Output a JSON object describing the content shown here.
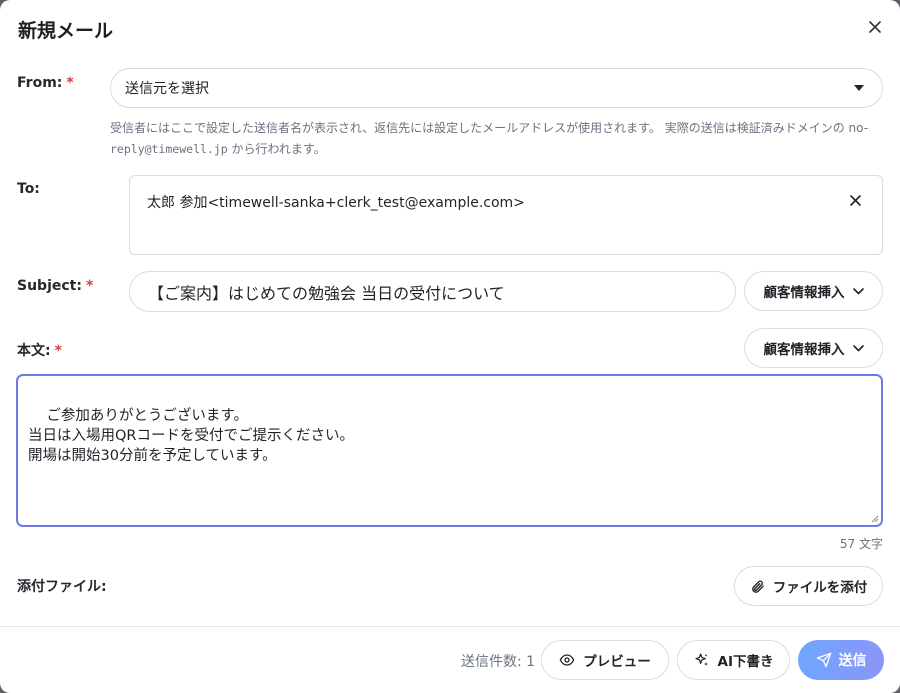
{
  "dialog": {
    "title": "新規メール"
  },
  "from": {
    "label": "From:",
    "required_mark": "*",
    "select_value": "送信元を選択",
    "help_line1": "受信者にはここで設定した送信者名が表示され、返信先には設定したメールアドレスが使用されます。 実際の送信は検証済みドメインの no-",
    "help_mono": "reply@timewell.jp",
    "help_tail": " から行われます。"
  },
  "to": {
    "label": "To:",
    "recipient": "太郎 参加<timewell-sanka+clerk_test@example.com>"
  },
  "subject": {
    "label": "Subject:",
    "required_mark": "*",
    "value": "【ご案内】はじめての勉強会 当日の受付について",
    "insert_button": "顧客情報挿入"
  },
  "body": {
    "label": "本文:",
    "required_mark": "*",
    "insert_button": "顧客情報挿入",
    "text": "ご参加ありがとうございます。\n当日は入場用QRコードを受付でご提示ください。\n開場は開始30分前を予定しています。",
    "char_count": "57 文字"
  },
  "attachment": {
    "label": "添付ファイル:",
    "button": "ファイルを添付"
  },
  "footer": {
    "send_count": "送信件数: 1",
    "preview_button": "プレビュー",
    "ai_button": "AI下書き",
    "send_button": "送信"
  },
  "colors": {
    "required": "#d93b3b",
    "focus_border": "#6d7ae0",
    "send_gradient_start": "#6fa6ff",
    "send_gradient_end": "#8b95f7"
  },
  "icons": {
    "close": "close-icon",
    "dropdown": "caret-down-icon",
    "chevron": "chevron-down-icon",
    "paperclip": "paperclip-icon",
    "eye": "eye-icon",
    "sparkles": "sparkles-icon",
    "send": "send-icon"
  }
}
